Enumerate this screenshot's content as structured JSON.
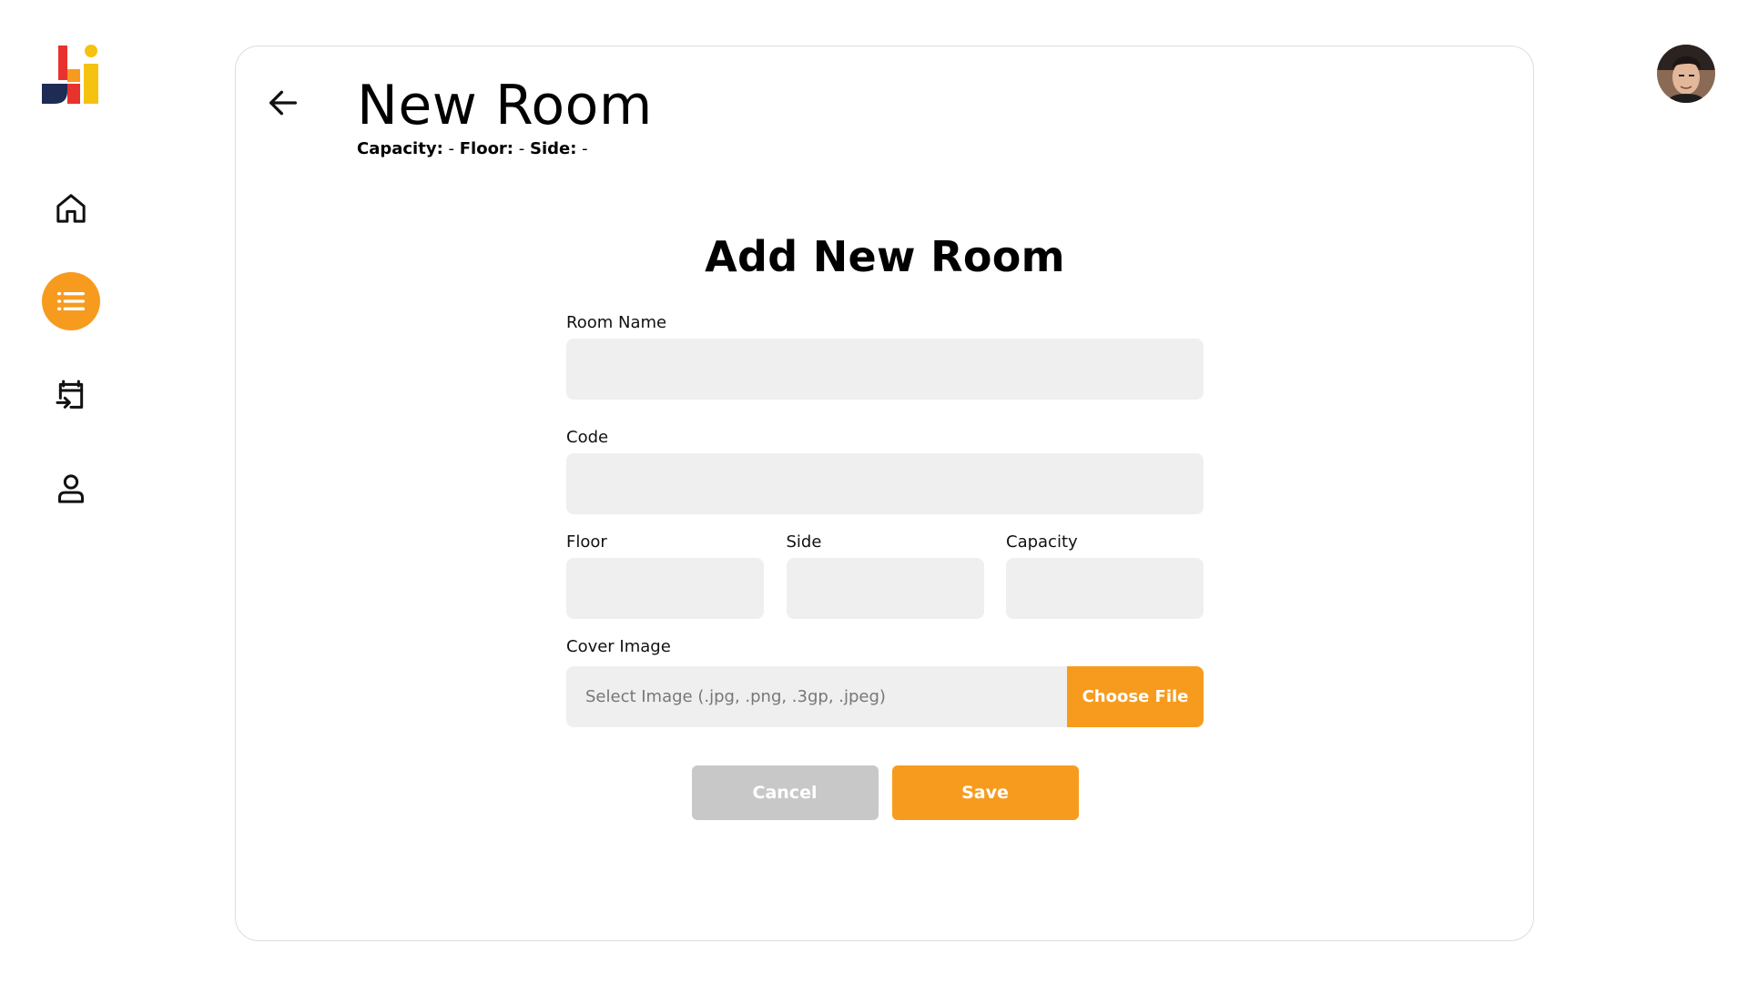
{
  "colors": {
    "accent": "#f79b1f",
    "cancel": "#c8c8c8",
    "input_bg": "#efefef"
  },
  "sidebar": {
    "logo_icon": "app-logo",
    "items": [
      {
        "icon": "home-icon",
        "active": false
      },
      {
        "icon": "list-icon",
        "active": true
      },
      {
        "icon": "calendar-import-icon",
        "active": false
      },
      {
        "icon": "user-icon",
        "active": false
      }
    ]
  },
  "header": {
    "title": "New Room",
    "meta": {
      "capacity_label": "Capacity:",
      "capacity_value": "-",
      "floor_label": "Floor:",
      "floor_value": "-",
      "side_label": "Side:",
      "side_value": "-"
    }
  },
  "form": {
    "title": "Add New Room",
    "room_name": {
      "label": "Room Name",
      "value": ""
    },
    "code": {
      "label": "Code",
      "value": ""
    },
    "floor": {
      "label": "Floor",
      "value": ""
    },
    "side": {
      "label": "Side",
      "value": ""
    },
    "capacity": {
      "label": "Capacity",
      "value": ""
    },
    "cover_image": {
      "label": "Cover Image",
      "placeholder": "Select Image (.jpg, .png, .3gp, .jpeg)",
      "button_label": "Choose File"
    },
    "cancel_label": "Cancel",
    "save_label": "Save"
  }
}
